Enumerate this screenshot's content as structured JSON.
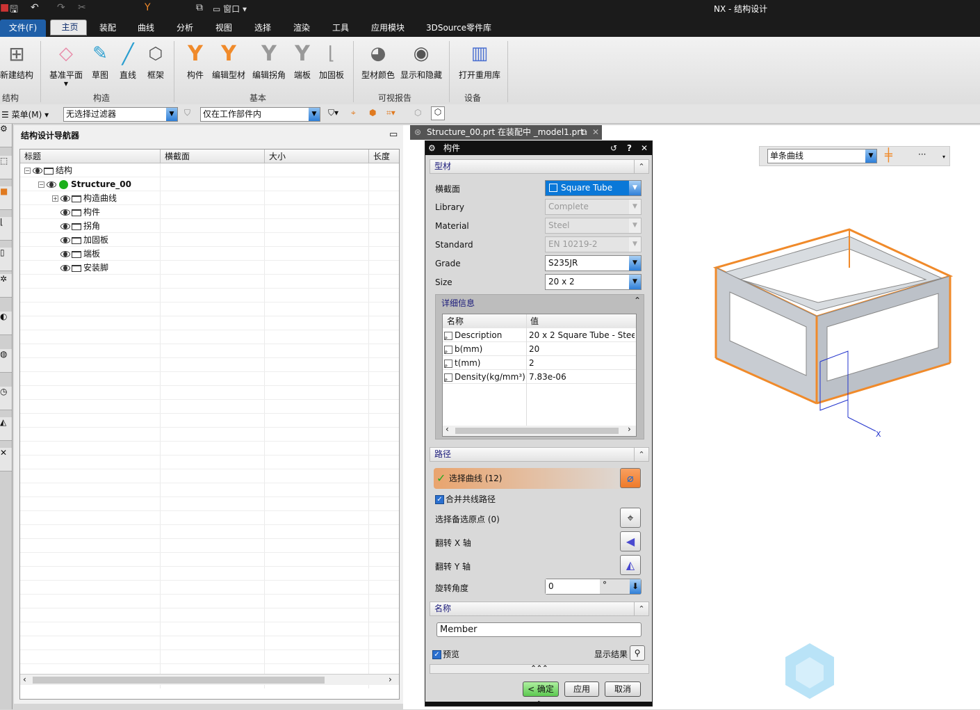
{
  "window": {
    "title": "NX - 结构设计",
    "quick_access_window": "窗口"
  },
  "menu_tabs": [
    "文件(F)",
    "主页",
    "装配",
    "曲线",
    "分析",
    "视图",
    "选择",
    "渲染",
    "工具",
    "应用模块",
    "3DSource零件库"
  ],
  "ribbon": {
    "buttons": [
      {
        "label": "新建结构",
        "icon": "new-structure-icon"
      },
      {
        "label": "基准平面",
        "icon": "datum-plane-icon"
      },
      {
        "label": "草图",
        "icon": "sketch-icon"
      },
      {
        "label": "直线",
        "icon": "line-icon"
      },
      {
        "label": "框架",
        "icon": "frame-icon"
      },
      {
        "label": "构件",
        "icon": "member-icon"
      },
      {
        "label": "编辑型材",
        "icon": "edit-profile-icon"
      },
      {
        "label": "编辑拐角",
        "icon": "edit-corner-icon"
      },
      {
        "label": "端板",
        "icon": "end-plate-icon"
      },
      {
        "label": "加固板",
        "icon": "gusset-icon"
      },
      {
        "label": "型材颜色",
        "icon": "profile-color-icon"
      },
      {
        "label": "显示和隐藏",
        "icon": "show-hide-icon"
      },
      {
        "label": "打开重用库",
        "icon": "reuse-library-icon"
      }
    ],
    "groups": [
      "结构",
      "构造",
      "基本",
      "可视报告",
      "设备"
    ]
  },
  "toolbar": {
    "menu": "菜单(M)",
    "filter": "无选择过滤器",
    "scope": "仅在工作部件内"
  },
  "navigator": {
    "title": "结构设计导航器",
    "columns": [
      "标题",
      "横截面",
      "大小",
      "长度"
    ],
    "rows": [
      {
        "label": "结构",
        "level": 0,
        "exp": "−"
      },
      {
        "label": "Structure_00",
        "level": 1,
        "exp": "−",
        "bold": true
      },
      {
        "label": "构造曲线",
        "level": 2,
        "exp": "+"
      },
      {
        "label": "构件",
        "level": 2
      },
      {
        "label": "拐角",
        "level": 2
      },
      {
        "label": "加固板",
        "level": 2
      },
      {
        "label": "端板",
        "level": 2
      },
      {
        "label": "安装脚",
        "level": 2
      }
    ]
  },
  "doc_tab": "Structure_00.prt 在装配中 _model1.prt",
  "selection_filter": "单条曲线",
  "dialog": {
    "title": "构件",
    "profile": {
      "header": "型材",
      "fields": [
        {
          "label": "横截面",
          "value": "Square Tube",
          "state": "selected"
        },
        {
          "label": "Library",
          "value": "Complete",
          "state": "disabled"
        },
        {
          "label": "Material",
          "value": "Steel",
          "state": "disabled"
        },
        {
          "label": "Standard",
          "value": "EN 10219-2",
          "state": "disabled"
        },
        {
          "label": "Grade",
          "value": "S235JR",
          "state": "enabled"
        },
        {
          "label": "Size",
          "value": "20 x 2",
          "state": "enabled"
        }
      ],
      "details": {
        "header": "详细信息",
        "columns": [
          "名称",
          "值"
        ],
        "rows": [
          [
            "Description",
            "20 x 2 Square Tube - Stee"
          ],
          [
            "b(mm)",
            "20"
          ],
          [
            "t(mm)",
            "2"
          ],
          [
            "Density(kg/mm³)",
            "7.83e-06"
          ]
        ]
      }
    },
    "path": {
      "header": "路径",
      "select_curve": "选择曲线 (12)",
      "merge": "合并共线路径",
      "origin": "选择备选原点 (0)",
      "flip_x": "翻转 X 轴",
      "flip_y": "翻转 Y 轴",
      "rotate_label": "旋转角度",
      "rotate_value": "0",
      "rotate_unit": "°"
    },
    "name": {
      "header": "名称",
      "value": "Member"
    },
    "preview": "预览",
    "show_result": "显示结果",
    "ok": "< 确定 >",
    "apply": "应用",
    "cancel": "取消"
  },
  "colors": {
    "accent_orange": "#f08a2a",
    "selection_blue": "#0a78d8"
  }
}
